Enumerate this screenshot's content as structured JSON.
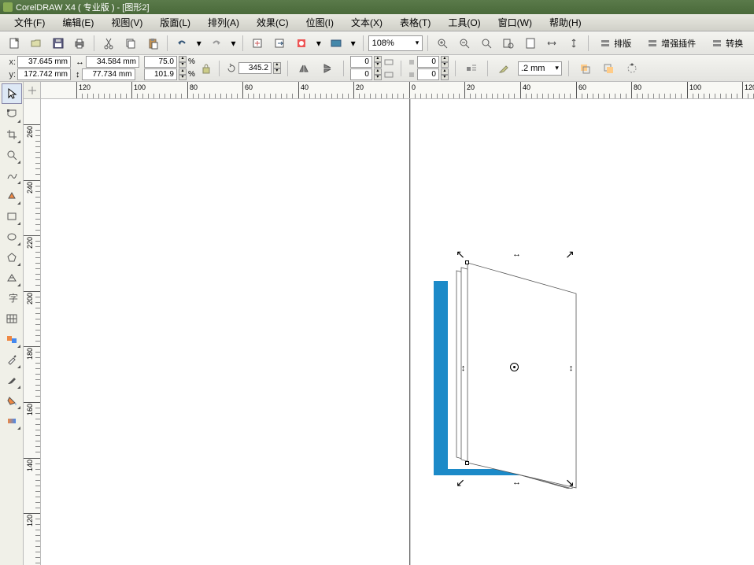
{
  "title": "CorelDRAW X4 ( 专业版 ) - [图形2]",
  "menu": [
    "文件(F)",
    "编辑(E)",
    "视图(V)",
    "版面(L)",
    "排列(A)",
    "效果(C)",
    "位图(I)",
    "文本(X)",
    "表格(T)",
    "工具(O)",
    "窗口(W)",
    "帮助(H)"
  ],
  "zoom": "108%",
  "toolbar_right": [
    "排版",
    "增强插件",
    "转换"
  ],
  "coords": {
    "x": "37.645 mm",
    "y": "172.742 mm"
  },
  "size": {
    "w": "34.584 mm",
    "h": "77.734 mm"
  },
  "scale": {
    "x": "75.0",
    "y": "101.9"
  },
  "scale_unit": "%",
  "rotation": "345.2",
  "skew": {
    "x": "0",
    "y": "0"
  },
  "offset": {
    "x": "0",
    "y": "0"
  },
  "outline": ".2 mm",
  "ruler_h": [
    {
      "p": 45,
      "v": "120"
    },
    {
      "p": 115,
      "v": "100"
    },
    {
      "p": 186,
      "v": "80"
    },
    {
      "p": 256,
      "v": "60"
    },
    {
      "p": 327,
      "v": "40"
    },
    {
      "p": 397,
      "v": "20"
    },
    {
      "p": 468,
      "v": "0"
    },
    {
      "p": 538,
      "v": "20"
    },
    {
      "p": 609,
      "v": "40"
    },
    {
      "p": 680,
      "v": "60"
    },
    {
      "p": 750,
      "v": "80"
    },
    {
      "p": 821,
      "v": "100"
    },
    {
      "p": 891,
      "v": "120"
    }
  ],
  "ruler_v": [
    {
      "p": 32,
      "v": "260"
    },
    {
      "p": 103,
      "v": "240"
    },
    {
      "p": 173,
      "v": "220"
    },
    {
      "p": 244,
      "v": "200"
    },
    {
      "p": 314,
      "v": "180"
    },
    {
      "p": 385,
      "v": "160"
    },
    {
      "p": 456,
      "v": "140"
    },
    {
      "p": 526,
      "v": "120"
    }
  ]
}
